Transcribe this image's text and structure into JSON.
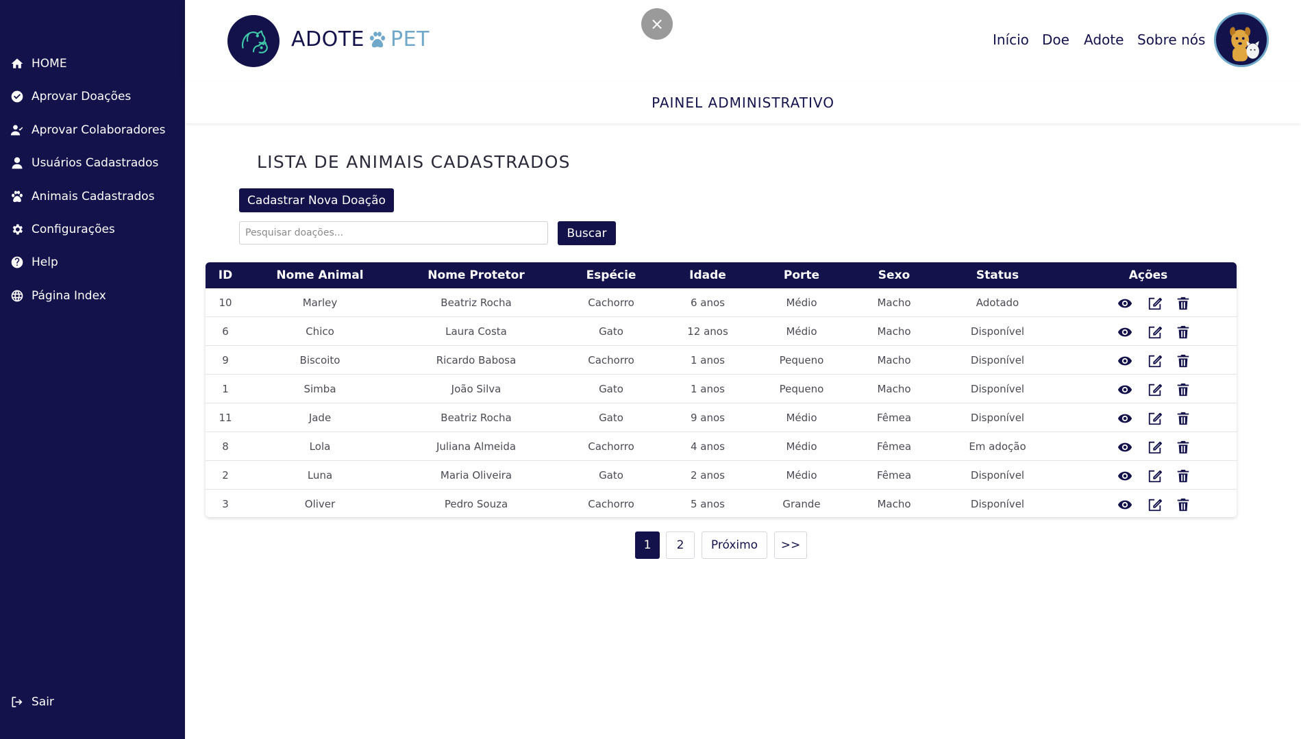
{
  "sidebar": {
    "items": [
      {
        "label": "HOME",
        "icon": "home-icon"
      },
      {
        "label": "Aprovar Doações",
        "icon": "check-circle-icon"
      },
      {
        "label": "Aprovar Colaboradores",
        "icon": "user-check-icon"
      },
      {
        "label": "Usuários Cadastrados",
        "icon": "user-icon"
      },
      {
        "label": "Animais Cadastrados",
        "icon": "paw-icon"
      },
      {
        "label": "Configurações",
        "icon": "gear-icon"
      },
      {
        "label": "Help",
        "icon": "help-icon"
      },
      {
        "label": "Página Index",
        "icon": "globe-icon"
      }
    ],
    "logout": {
      "label": "Sair",
      "icon": "sign-out-icon"
    }
  },
  "header": {
    "brand_left": "ADOTE",
    "brand_right": "PET",
    "close_label": "×",
    "nav": [
      "Início",
      "Doe",
      "Adote",
      "Sobre nós"
    ]
  },
  "subheader": {
    "title": "PAINEL ADMINISTRATIVO"
  },
  "main": {
    "title": "LISTA DE ANIMAIS CADASTRADOS",
    "new_button": "Cadastrar Nova Doação",
    "search_placeholder": "Pesquisar doações...",
    "search_button": "Buscar"
  },
  "table": {
    "columns": [
      "ID",
      "Nome Animal",
      "Nome Protetor",
      "Espécie",
      "Idade",
      "Porte",
      "Sexo",
      "Status",
      "Ações"
    ],
    "rows": [
      [
        "10",
        "Marley",
        "Beatriz Rocha",
        "Cachorro",
        "6 anos",
        "Médio",
        "Macho",
        "Adotado"
      ],
      [
        "6",
        "Chico",
        "Laura Costa",
        "Gato",
        "12 anos",
        "Médio",
        "Macho",
        "Disponível"
      ],
      [
        "9",
        "Biscoito",
        "Ricardo Babosa",
        "Cachorro",
        "1 anos",
        "Pequeno",
        "Macho",
        "Disponível"
      ],
      [
        "1",
        "Simba",
        "João Silva",
        "Gato",
        "1 anos",
        "Pequeno",
        "Macho",
        "Disponível"
      ],
      [
        "11",
        "Jade",
        "Beatriz Rocha",
        "Gato",
        "9 anos",
        "Médio",
        "Fêmea",
        "Disponível"
      ],
      [
        "8",
        "Lola",
        "Juliana Almeida",
        "Cachorro",
        "4 anos",
        "Médio",
        "Fêmea",
        "Em adoção"
      ],
      [
        "2",
        "Luna",
        "Maria Oliveira",
        "Gato",
        "2 anos",
        "Médio",
        "Fêmea",
        "Disponível"
      ],
      [
        "3",
        "Oliver",
        "Pedro Souza",
        "Cachorro",
        "5 anos",
        "Grande",
        "Macho",
        "Disponível"
      ]
    ]
  },
  "pagination": {
    "pages": [
      "1",
      "2"
    ],
    "current": "1",
    "next_label": "Próximo",
    "last_label": ">>"
  },
  "colors": {
    "primary": "#13124b",
    "accent": "#6fa8c9"
  }
}
